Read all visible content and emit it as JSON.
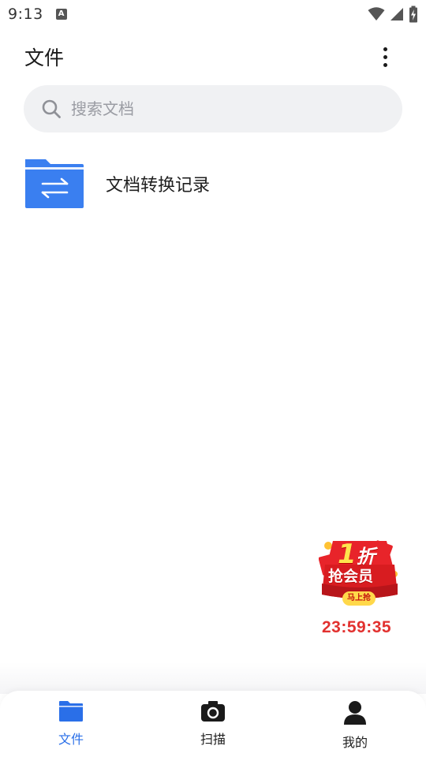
{
  "status_bar": {
    "time": "9:13",
    "notification_icon": "a-letter-icon",
    "notification_letter": "A",
    "icons": [
      "wifi-icon",
      "cell-signal-icon",
      "battery-charging-icon"
    ]
  },
  "header": {
    "title": "文件",
    "menu_icon": "more-vert-icon"
  },
  "search": {
    "placeholder": "搜索文档",
    "icon": "search-icon"
  },
  "files": [
    {
      "name": "文档转换记录",
      "icon": "folder-convert-icon"
    }
  ],
  "promo": {
    "zhe_number": "1",
    "zhe_text": "折",
    "line2": "抢会员",
    "chip": "马上抢",
    "timer": "23:59:35"
  },
  "bottom_nav": {
    "items": [
      {
        "label": "文件",
        "icon": "folder-icon",
        "active": true
      },
      {
        "label": "扫描",
        "icon": "camera-icon",
        "active": false
      },
      {
        "label": "我的",
        "icon": "person-icon",
        "active": false
      }
    ]
  },
  "colors": {
    "accent": "#2a6fe8",
    "folder": "#3a7ff0",
    "timer": "#e2312f",
    "search_bg": "#f0f1f3"
  }
}
